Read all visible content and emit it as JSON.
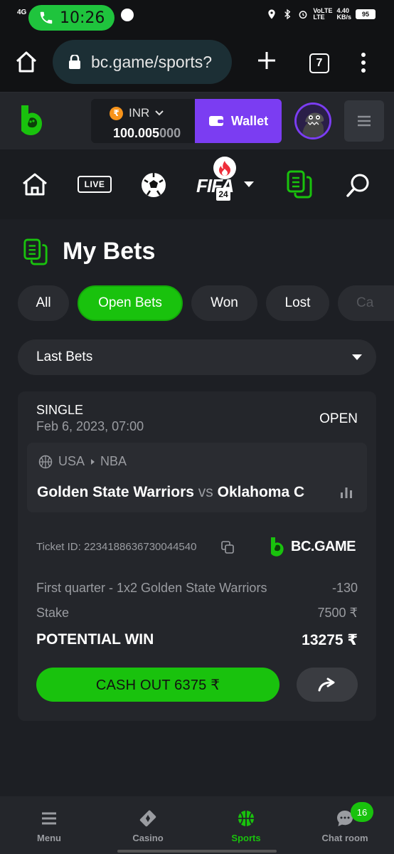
{
  "status_bar": {
    "network": "4G",
    "time": "10:26",
    "data_speed": "4.40",
    "data_unit": "KB/s",
    "net_type_top": "VoLTE",
    "net_type_bottom": "LTE",
    "battery": "95"
  },
  "browser": {
    "url": "bc.game/sports?",
    "tab_count": "7"
  },
  "header": {
    "currency": "INR",
    "balance_main": "100.005",
    "balance_dim": "000",
    "wallet_label": "Wallet"
  },
  "sports_nav": {
    "live_label": "LIVE",
    "fifa_label": "FIFA",
    "fifa_year": "24"
  },
  "page": {
    "title": "My Bets"
  },
  "filters": [
    "All",
    "Open Bets",
    "Won",
    "Lost",
    "Ca"
  ],
  "active_filter": "Open Bets",
  "dropdown": {
    "selected": "Last Bets"
  },
  "bet": {
    "type": "SINGLE",
    "date": "Feb 6, 2023, 07:00",
    "status": "OPEN",
    "league_country": "USA",
    "league": "NBA",
    "home_team": "Golden State Warriors",
    "vs": "vs",
    "away_team": "Oklahoma C",
    "ticket_label": "Ticket ID: 2234188636730044540",
    "brand": "BC.GAME",
    "market": "First quarter - 1x2 Golden State Warriors",
    "odds": "-130",
    "stake_label": "Stake",
    "stake_value": "7500 ₹",
    "potential_label": "POTENTIAL WIN",
    "potential_value": "13275 ₹",
    "cashout_label": "CASH OUT 6375 ₹"
  },
  "bottom_nav": {
    "items": [
      "Menu",
      "Casino",
      "Sports",
      "Chat room"
    ],
    "active": "Sports",
    "chat_badge": "16"
  },
  "colors": {
    "accent_green": "#19c20d",
    "wallet_purple": "#7b3df2",
    "background": "#1d1f24"
  }
}
